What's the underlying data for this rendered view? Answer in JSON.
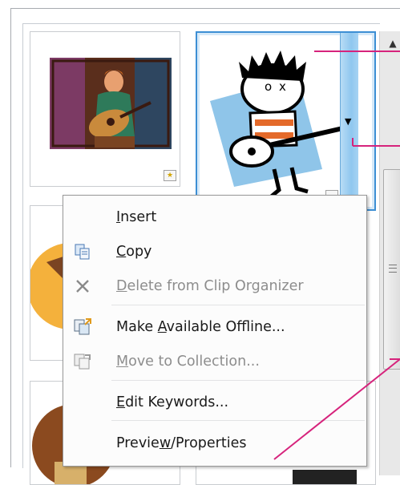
{
  "menu": {
    "items": [
      {
        "label": "Insert",
        "disabled": false,
        "icon": "none"
      },
      {
        "label": "Copy",
        "disabled": false,
        "icon": "copy-icon"
      },
      {
        "label": "Delete from Clip Organizer",
        "disabled": true,
        "icon": "delete-x-icon"
      },
      {
        "label": "Make Available Offline...",
        "disabled": false,
        "icon": "offline-icon"
      },
      {
        "label": "Move to Collection...",
        "disabled": true,
        "icon": "move-icon"
      },
      {
        "label": "Edit Keywords...",
        "disabled": false,
        "icon": "none"
      },
      {
        "label": "Preview/Properties",
        "disabled": false,
        "icon": "none"
      }
    ]
  },
  "colors": {
    "selection_border": "#3d8fd4",
    "callout_line": "#d6237c",
    "menu_border": "#979797"
  },
  "icons": {
    "scroll_up": "▲",
    "clip_badge": "★",
    "dropdown": "▼"
  }
}
